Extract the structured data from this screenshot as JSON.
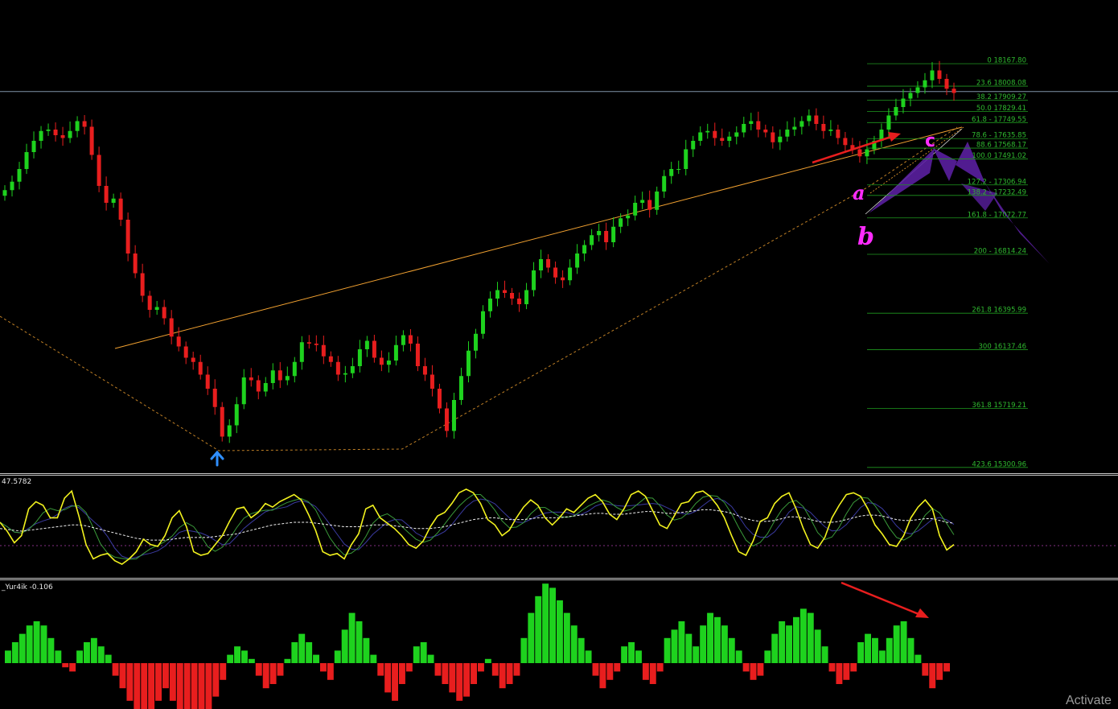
{
  "corner_mark": "\"",
  "colors": {
    "bull": "#1ed21e",
    "bear": "#e81e1e",
    "trendline": "#f0a030",
    "fib": "#1f9a1f",
    "price_line": "#7f93a8",
    "harmonic_fill": "#5a1fa0",
    "stoch_main": "#f2f21e",
    "stoch_signal_a": "#3a9a3a",
    "stoch_signal_b": "#3a3aa0",
    "arrow_red": "#e81e1e",
    "label_magenta": "#ff2bff",
    "buy_arrow": "#2f8fff"
  },
  "main": {
    "price_line_value": 17970,
    "pattern_labels": {
      "a": "a",
      "b": "b",
      "c": "c"
    },
    "buy_arrow_icon": "up-arrow-icon",
    "fib_levels": [
      {
        "ratio": "0",
        "price": "18167.80",
        "text": "0 18167.80"
      },
      {
        "ratio": "23.6",
        "price": "18008.08",
        "text": "23.6 18008.08"
      },
      {
        "ratio": "38.2",
        "price": "17909.27",
        "text": "38.2 17909.27"
      },
      {
        "ratio": "50.0",
        "price": "17829.41",
        "text": "50.0 17829.41"
      },
      {
        "ratio": "61.8",
        "price": "17749.55",
        "text": "61.8 - 17749.55"
      },
      {
        "ratio": "78.6",
        "price": "17635.85",
        "text": "78.6 - 17635.85"
      },
      {
        "ratio": "88.6",
        "price": "17568.17",
        "text": "88.6 17568.17"
      },
      {
        "ratio": "100.0",
        "price": "17491.02",
        "text": "100.0 17491.02"
      },
      {
        "ratio": "127.2",
        "price": "17306.94",
        "text": "127.2 - 17306.94"
      },
      {
        "ratio": "138.2",
        "price": "17232.49",
        "text": "138.2 - 17232.49"
      },
      {
        "ratio": "161.8",
        "price": "17072.77",
        "text": "161.8 - 17072.77"
      },
      {
        "ratio": "200",
        "price": "16814.24",
        "text": "200 - 16814.24"
      },
      {
        "ratio": "261.8",
        "price": "16395.99",
        "text": "261.8 16395.99"
      },
      {
        "ratio": "300",
        "price": "16137.46",
        "text": "300 16137.46"
      },
      {
        "ratio": "361.8",
        "price": "15719.21",
        "text": "361.8 15719.21"
      },
      {
        "ratio": "423.6",
        "price": "15300.96",
        "text": "423.6 15300.96"
      }
    ]
  },
  "oscillator": {
    "label": "47.5782",
    "ylim": [
      0,
      100
    ]
  },
  "histogram": {
    "label": "_Yur4ik -0.106"
  },
  "watermark": "Activate",
  "chart_data": [
    {
      "type": "candlestick",
      "title": "",
      "xlabel": "",
      "ylabel": "",
      "ylim": [
        15260,
        18620
      ],
      "note_candles": "approximate closing path in price units; candles colored green when close rises, red when falls",
      "closes": [
        17270,
        17330,
        17420,
        17540,
        17620,
        17690,
        17700,
        17660,
        17640,
        17690,
        17760,
        17720,
        17520,
        17300,
        17180,
        17210,
        17060,
        16820,
        16680,
        16520,
        16420,
        16440,
        16360,
        16230,
        16160,
        16080,
        16050,
        15960,
        15860,
        15730,
        15520,
        15600,
        15750,
        15940,
        15920,
        15840,
        15900,
        15990,
        15920,
        15950,
        16050,
        16190,
        16180,
        16170,
        16090,
        16050,
        15960,
        15970,
        16020,
        16140,
        16200,
        16080,
        16030,
        16060,
        16170,
        16240,
        16180,
        16020,
        15960,
        15860,
        15720,
        15560,
        15780,
        15950,
        16130,
        16250,
        16410,
        16500,
        16560,
        16540,
        16500,
        16460,
        16560,
        16700,
        16780,
        16720,
        16650,
        16630,
        16720,
        16820,
        16880,
        16950,
        16980,
        16900,
        17010,
        17070,
        17090,
        17180,
        17200,
        17130,
        17260,
        17370,
        17420,
        17420,
        17560,
        17620,
        17680,
        17690,
        17640,
        17620,
        17650,
        17680,
        17740,
        17760,
        17700,
        17680,
        17610,
        17650,
        17700,
        17720,
        17760,
        17800,
        17740,
        17690,
        17700,
        17640,
        17590,
        17560,
        17510,
        17560,
        17620,
        17700,
        17800,
        17860,
        17920,
        17960,
        18000,
        18050,
        18120,
        18060,
        17990,
        17960
      ],
      "price_line": 17970,
      "trendlines": [
        {
          "name": "upper",
          "from": [
            0.1,
            16530
          ],
          "to": [
            0.86,
            18190
          ]
        },
        {
          "name": "lower",
          "from": [
            0.0,
            16840
          ],
          "to": [
            0.86,
            18180
          ]
        }
      ],
      "fib_levels": [
        [
          0,
          18167.8
        ],
        [
          23.6,
          18008.08
        ],
        [
          38.2,
          17909.27
        ],
        [
          50.0,
          17829.41
        ],
        [
          61.8,
          17749.55
        ],
        [
          78.6,
          17635.85
        ],
        [
          88.6,
          17568.17
        ],
        [
          100.0,
          17491.02
        ],
        [
          127.2,
          17306.94
        ],
        [
          138.2,
          17232.49
        ],
        [
          161.8,
          17072.77
        ],
        [
          200,
          16814.24
        ],
        [
          261.8,
          16395.99
        ],
        [
          300,
          16137.46
        ],
        [
          361.8,
          15719.21
        ],
        [
          423.6,
          15300.96
        ]
      ]
    },
    {
      "type": "line",
      "title": "47.5782",
      "ylim": [
        0,
        100
      ],
      "series": [
        {
          "values": [
            55,
            45,
            32,
            40,
            70,
            78,
            74,
            60,
            60,
            82,
            90,
            62,
            30,
            14,
            18,
            20,
            12,
            8,
            14,
            22,
            36,
            30,
            28,
            40,
            60,
            68,
            50,
            22,
            18,
            20,
            30,
            40,
            56,
            70,
            72,
            60,
            66,
            76,
            72,
            78,
            82,
            86,
            80,
            64,
            46,
            22,
            18,
            20,
            14,
            30,
            42,
            70,
            74,
            60,
            54,
            48,
            40,
            30,
            26,
            34,
            50,
            62,
            66,
            76,
            88,
            92,
            88,
            76,
            58,
            52,
            40,
            46,
            60,
            72,
            80,
            74,
            60,
            52,
            60,
            70,
            66,
            74,
            82,
            86,
            78,
            64,
            58,
            70,
            86,
            90,
            84,
            68,
            52,
            48,
            62,
            76,
            78,
            88,
            90,
            84,
            74,
            60,
            40,
            22,
            18,
            34,
            56,
            60,
            76,
            84,
            88,
            70,
            48,
            30,
            26,
            38,
            60,
            74,
            86,
            88,
            84,
            70,
            52,
            42,
            30,
            28,
            40,
            60,
            72,
            80,
            70,
            40,
            24,
            30
          ]
        },
        {
          "values": [
            48,
            47,
            46,
            45,
            46,
            47,
            48,
            49,
            50,
            51,
            52,
            52,
            51,
            49,
            47,
            45,
            43,
            41,
            39,
            37,
            36,
            35,
            35,
            35,
            36,
            37,
            38,
            38,
            38,
            38,
            39,
            40,
            41,
            42,
            44,
            46,
            48,
            50,
            52,
            53,
            54,
            55,
            55,
            55,
            54,
            53,
            52,
            51,
            50,
            50,
            50,
            51,
            52,
            52,
            52,
            51,
            50,
            49,
            48,
            48,
            48,
            49,
            50,
            52,
            54,
            56,
            58,
            59,
            60,
            60,
            59,
            58,
            58,
            58,
            59,
            60,
            60,
            60,
            60,
            61,
            62,
            63,
            64,
            65,
            65,
            64,
            64,
            64,
            65,
            66,
            67,
            67,
            66,
            65,
            65,
            66,
            67,
            68,
            69,
            69,
            68,
            67,
            65,
            62,
            59,
            57,
            56,
            56,
            57,
            59,
            61,
            61,
            60,
            58,
            56,
            55,
            55,
            56,
            58,
            60,
            62,
            63,
            63,
            62,
            60,
            58,
            57,
            57,
            58,
            59,
            59,
            57,
            55,
            54
          ]
        }
      ]
    },
    {
      "type": "bar",
      "title": "_Yur4ik -0.106",
      "values": [
        0.3,
        0.5,
        0.7,
        0.9,
        1.0,
        0.9,
        0.6,
        0.3,
        -0.1,
        -0.2,
        0.3,
        0.5,
        0.6,
        0.4,
        0.2,
        -0.3,
        -0.6,
        -0.9,
        -1.1,
        -1.3,
        -1.2,
        -0.9,
        -0.6,
        -0.9,
        -1.4,
        -1.7,
        -1.8,
        -1.5,
        -1.2,
        -0.8,
        -0.4,
        0.2,
        0.4,
        0.3,
        0.1,
        -0.3,
        -0.6,
        -0.5,
        -0.3,
        0.1,
        0.5,
        0.7,
        0.5,
        0.2,
        -0.2,
        -0.4,
        0.3,
        0.8,
        1.2,
        1.0,
        0.6,
        0.2,
        -0.3,
        -0.7,
        -0.9,
        -0.5,
        -0.2,
        0.4,
        0.5,
        0.2,
        -0.3,
        -0.5,
        -0.7,
        -0.9,
        -0.8,
        -0.5,
        -0.2,
        0.1,
        -0.3,
        -0.6,
        -0.5,
        -0.3,
        0.6,
        1.2,
        1.6,
        1.9,
        1.8,
        1.5,
        1.2,
        0.9,
        0.6,
        0.3,
        -0.3,
        -0.6,
        -0.4,
        -0.2,
        0.4,
        0.5,
        0.3,
        -0.4,
        -0.5,
        -0.2,
        0.6,
        0.8,
        1.0,
        0.7,
        0.4,
        0.9,
        1.2,
        1.1,
        0.9,
        0.6,
        0.3,
        -0.2,
        -0.4,
        -0.3,
        0.3,
        0.7,
        1.0,
        0.9,
        1.1,
        1.3,
        1.2,
        0.8,
        0.4,
        -0.2,
        -0.5,
        -0.4,
        -0.2,
        0.5,
        0.7,
        0.6,
        0.3,
        0.6,
        0.9,
        1.0,
        0.6,
        0.2,
        -0.3,
        -0.6,
        -0.4,
        -0.2
      ]
    }
  ]
}
